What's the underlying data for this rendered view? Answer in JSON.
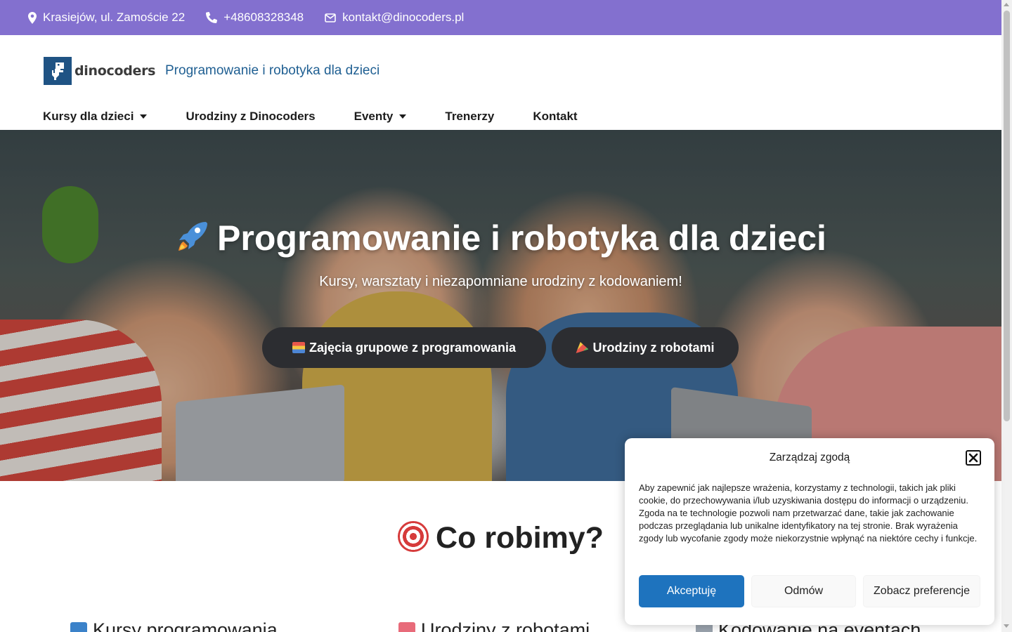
{
  "topbar": {
    "address": "Krasiejów, ul. Zamoście 22",
    "phone": "+48608328348",
    "email": "kontakt@dinocoders.pl"
  },
  "header": {
    "logo_text": "dinocoders",
    "tagline": "Programowanie i robotyka dla dzieci"
  },
  "nav": {
    "items": [
      {
        "label": "Kursy dla dzieci",
        "dropdown": true
      },
      {
        "label": "Urodziny z Dinocoders",
        "dropdown": false
      },
      {
        "label": "Eventy",
        "dropdown": true
      },
      {
        "label": "Trenerzy",
        "dropdown": false
      },
      {
        "label": "Kontakt",
        "dropdown": false
      }
    ]
  },
  "hero": {
    "title": "Programowanie i robotyka dla dzieci",
    "subtitle": "Kursy, warsztaty i niezapomniane urodziny z kodowaniem!",
    "button_courses": "Zajęcia grupowe z programowania",
    "button_birthday": "Urodziny z robotami"
  },
  "section": {
    "title": "Co robimy?",
    "cards": [
      "Kursy programowania",
      "Urodziny z robotami",
      "Kodowanie na eventach"
    ]
  },
  "consent": {
    "title": "Zarządzaj zgodą",
    "body": "Aby zapewnić jak najlepsze wrażenia, korzystamy z technologii, takich jak pliki cookie, do przechowywania i/lub uzyskiwania dostępu do informacji o urządzeniu. Zgoda na te technologie pozwoli nam przetwarzać dane, takie jak zachowanie podczas przeglądania lub unikalne identyfikatory na tej stronie. Brak wyrażenia zgody lub wycofanie zgody może niekorzystnie wpłynąć na niektóre cechy i funkcje.",
    "accept": "Akceptuję",
    "deny": "Odmów",
    "preferences": "Zobacz preferencje"
  },
  "colors": {
    "topbar_bg": "#8370cf",
    "accent_blue": "#1e73be",
    "hero_button_bg": "#2c2d31",
    "tagline": "#1f5f92"
  },
  "icons": [
    "map-pin-icon",
    "phone-icon",
    "mail-icon",
    "rocket-icon",
    "books-icon",
    "party-popper-icon",
    "target-icon",
    "laptop-icon",
    "birthday-cake-icon",
    "robot-icon",
    "close-icon"
  ]
}
